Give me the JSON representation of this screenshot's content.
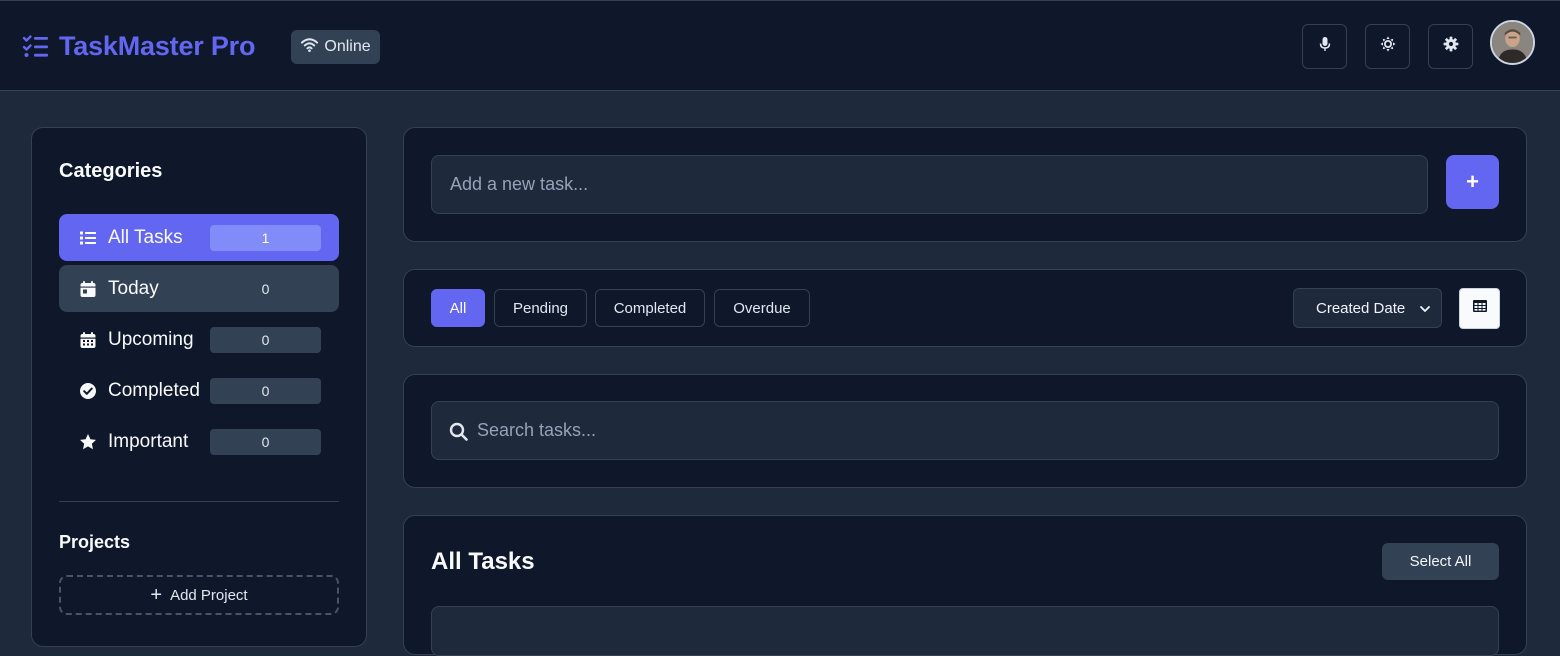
{
  "header": {
    "app_name": "TaskMaster Pro",
    "status": "Online",
    "buttons": [
      "microphone-icon",
      "theme-toggle-icon",
      "settings-icon"
    ]
  },
  "sidebar": {
    "title": "Categories",
    "items": [
      {
        "label": "All Tasks",
        "count": "1",
        "icon": "list-icon"
      },
      {
        "label": "Today",
        "count": "0",
        "icon": "calendar-day-icon"
      },
      {
        "label": "Upcoming",
        "count": "0",
        "icon": "calendar-icon"
      },
      {
        "label": "Completed",
        "count": "0",
        "icon": "check-circle-icon"
      },
      {
        "label": "Important",
        "count": "0",
        "icon": "star-icon"
      }
    ],
    "projects_title": "Projects",
    "add_project_label": "Add Project"
  },
  "add_task": {
    "placeholder": "Add a new task...",
    "button_label": "+"
  },
  "filters": {
    "tabs": [
      "All",
      "Pending",
      "Completed",
      "Overdue"
    ],
    "active": "All",
    "sort_value": "Created Date"
  },
  "search": {
    "placeholder": "Search tasks..."
  },
  "tasks": {
    "title": "All Tasks",
    "select_all_label": "Select All"
  },
  "colors": {
    "accent": "#6366f1",
    "surface": "#0f172a",
    "background": "#1e293b"
  }
}
